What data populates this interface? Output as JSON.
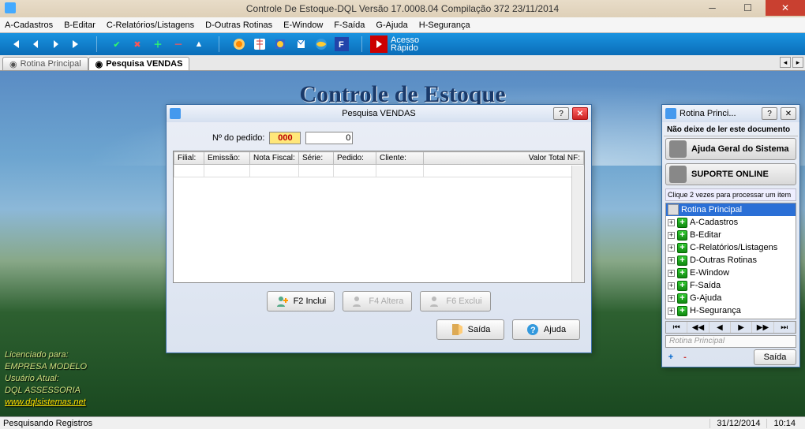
{
  "window": {
    "title": "Controle De Estoque-DQL  Versão  17.0008.04 Compilação 372  23/11/2014"
  },
  "menu": {
    "items": [
      "A-Cadastros",
      "B-Editar",
      "C-Relatórios/Listagens",
      "D-Outras Rotinas",
      "E-Window",
      "F-Saída",
      "G-Ajuda",
      "H-Segurança"
    ]
  },
  "toolbar": {
    "acesso1": "Acesso",
    "acesso2": "Rápido"
  },
  "tabs": {
    "t1": "Rotina Principal",
    "t2": "Pesquisa VENDAS"
  },
  "workspace": {
    "title": "Controle de Estoque"
  },
  "license": {
    "l1": "Licenciado para:",
    "l2": "EMPRESA MODELO",
    "l3": "Usuário Atual:",
    "l4": "DQL ASSESSORIA",
    "url": "www.dqlsistemas.net"
  },
  "pv": {
    "title": "Pesquisa VENDAS",
    "pedido_label": "Nº do pedido:",
    "pedido_v1": "000",
    "pedido_v2": "0",
    "cols": {
      "c1": "Filial:",
      "c2": "Emissão:",
      "c3": "Nota Fiscal:",
      "c4": "Série:",
      "c5": "Pedido:",
      "c6": "Cliente:",
      "c7": "Valor Total NF:"
    },
    "b_inclui": "F2 Inclui",
    "b_altera": "F4 Altera",
    "b_exclui": "F6 Exclui",
    "b_saida": "Saída",
    "b_ajuda": "Ajuda"
  },
  "rp": {
    "title": "Rotina Princi...",
    "doc": "Não deixe de ler este documento",
    "b1": "Ajuda Geral do Sistema",
    "b2": "SUPORTE ONLINE",
    "hint": "Clique 2 vezes para processar um item",
    "root": "Rotina Principal",
    "nodes": [
      "A-Cadastros",
      "B-Editar",
      "C-Relatórios/Listagens",
      "D-Outras Rotinas",
      "E-Window",
      "F-Saída",
      "G-Ajuda",
      "H-Segurança"
    ],
    "crumb": "Rotina Principal",
    "saida": "Saída"
  },
  "status": {
    "text": "Pesquisando Registros",
    "date": "31/12/2014",
    "time": "10:14"
  }
}
